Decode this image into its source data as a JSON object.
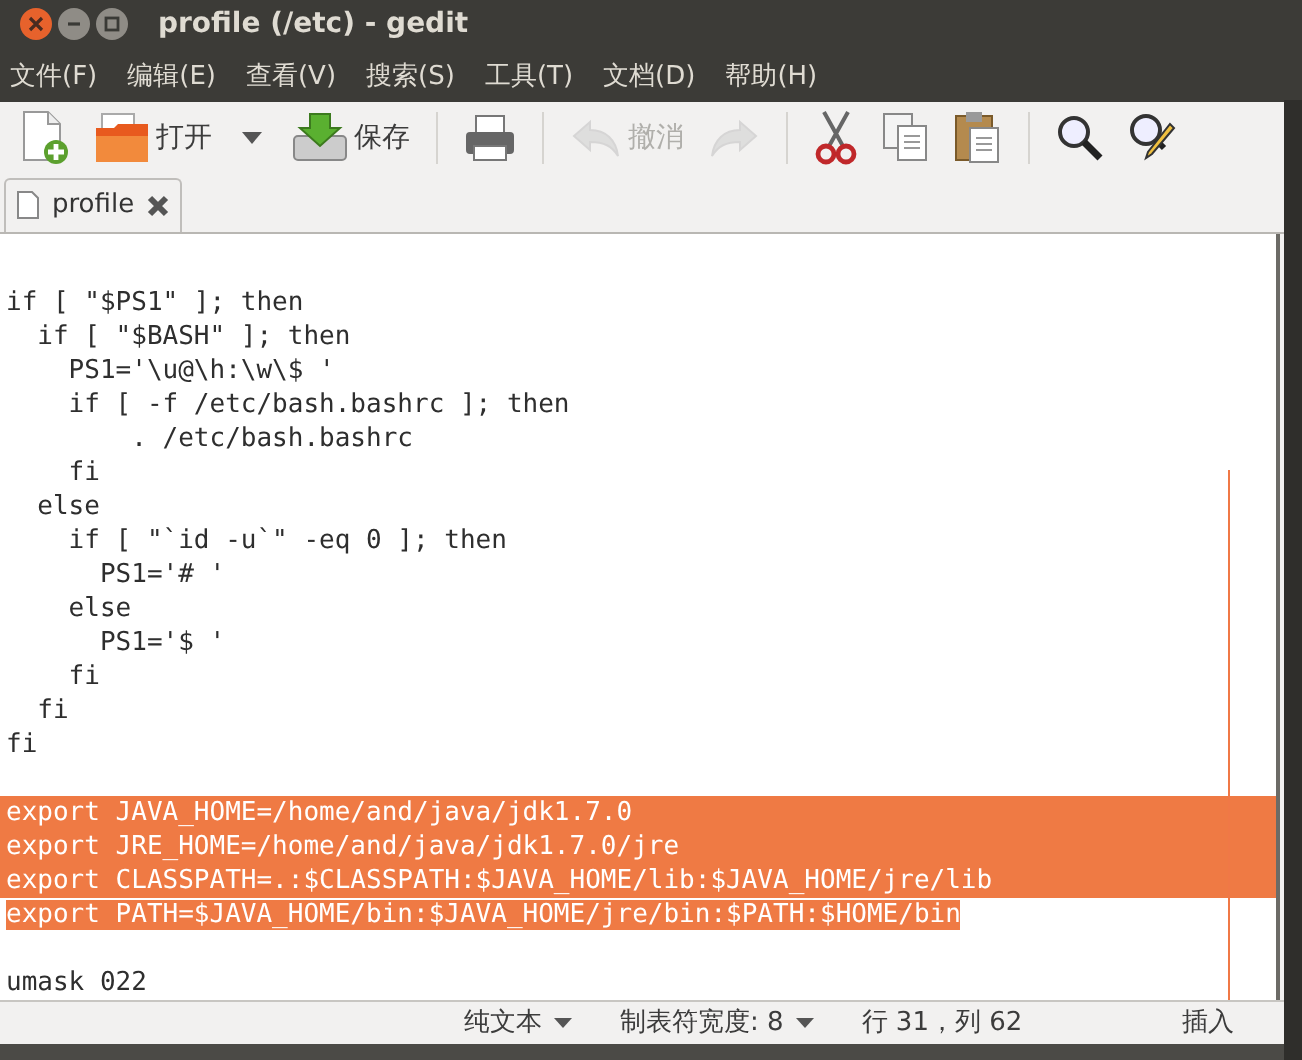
{
  "window": {
    "title": "profile (/etc) - gedit"
  },
  "menu": [
    "文件(F)",
    "编辑(E)",
    "查看(V)",
    "搜索(S)",
    "工具(T)",
    "文档(D)",
    "帮助(H)"
  ],
  "toolbar": [
    {
      "kind": "new",
      "disabled": false
    },
    {
      "kind": "open",
      "label": "打开",
      "disabled": false
    },
    {
      "kind": "dropdown",
      "disabled": false
    },
    {
      "kind": "save",
      "label": "保存",
      "disabled": false
    },
    {
      "kind": "sep"
    },
    {
      "kind": "print",
      "disabled": false
    },
    {
      "kind": "sep"
    },
    {
      "kind": "undo",
      "label": "撤消",
      "disabled": true
    },
    {
      "kind": "redo",
      "disabled": true
    },
    {
      "kind": "sep"
    },
    {
      "kind": "cut",
      "disabled": false
    },
    {
      "kind": "copy",
      "disabled": false
    },
    {
      "kind": "paste",
      "disabled": false
    },
    {
      "kind": "sep"
    },
    {
      "kind": "search",
      "disabled": false
    },
    {
      "kind": "replace",
      "disabled": false
    }
  ],
  "tabs": [
    {
      "label": "profile",
      "selected": true
    }
  ],
  "editor": {
    "lines": [
      {
        "selected": false
      },
      {
        "text": "if [ \"$PS1\" ]; then",
        "selected": false
      },
      {
        "text": "  if [ \"$BASH\" ]; then",
        "selected": false
      },
      {
        "text": "    PS1='\\u@\\h:\\w\\$ '",
        "selected": false
      },
      {
        "text": "    if [ -f /etc/bash.bashrc ]; then",
        "selected": false
      },
      {
        "text": "        . /etc/bash.bashrc",
        "selected": false
      },
      {
        "text": "    fi",
        "selected": false
      },
      {
        "text": "  else",
        "selected": false
      },
      {
        "text": "    if [ \"`id -u`\" -eq 0 ]; then",
        "selected": false
      },
      {
        "text": "      PS1='# '",
        "selected": false
      },
      {
        "text": "    else",
        "selected": false
      },
      {
        "text": "      PS1='$ '",
        "selected": false
      },
      {
        "text": "    fi",
        "selected": false
      },
      {
        "text": "  fi",
        "selected": false
      },
      {
        "text": "fi",
        "selected": false
      },
      {
        "selected": false
      },
      {
        "text": "export JAVA_HOME=/home/and/java/jdk1.7.0",
        "selected": true
      },
      {
        "text": "export JRE_HOME=/home/and/java/jdk1.7.0/jre",
        "selected": true
      },
      {
        "text": "export CLASSPATH=.:$CLASSPATH:$JAVA_HOME/lib:$JAVA_HOME/jre/lib",
        "selected": true
      },
      {
        "text": "export PATH=$JAVA_HOME/bin:$JAVA_HOME/jre/bin:$PATH:$HOME/bin",
        "selected": true
      },
      {
        "selected": false
      },
      {
        "text": "umask 022",
        "selected": false
      }
    ]
  },
  "status_bar": {
    "language": "纯文本",
    "tab_width": "制表符宽度: 8",
    "position": "行 31，列 62",
    "mode": "插入"
  }
}
